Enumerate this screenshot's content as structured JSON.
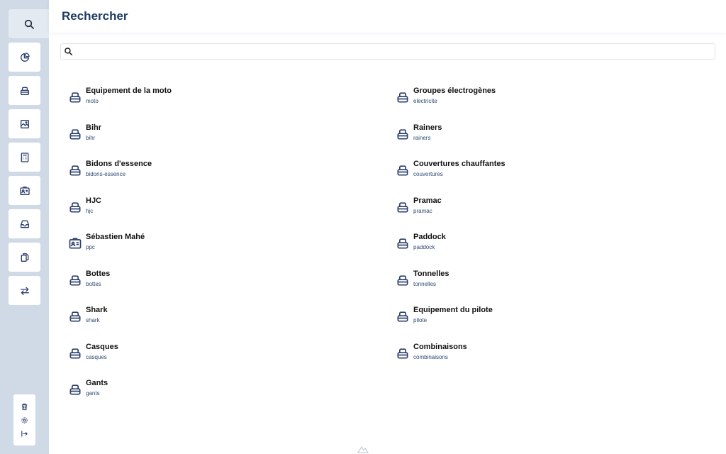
{
  "page": {
    "title": "Rechercher"
  },
  "search": {
    "value": "",
    "placeholder": ""
  },
  "sidebar": {
    "items": [
      {
        "icon": "search-icon",
        "active": true
      },
      {
        "icon": "pie-chart-icon"
      },
      {
        "icon": "category-icon"
      },
      {
        "icon": "image-icon"
      },
      {
        "icon": "calculator-icon"
      },
      {
        "icon": "id-card-icon"
      },
      {
        "icon": "inbox-icon"
      },
      {
        "icon": "copy-icon"
      },
      {
        "icon": "transfer-icon"
      }
    ],
    "bottom": [
      {
        "icon": "trash-icon"
      },
      {
        "icon": "settings-icon"
      },
      {
        "icon": "logout-icon"
      }
    ]
  },
  "results": {
    "left": [
      {
        "title": "Equipement de la moto",
        "slug": "moto",
        "icon": "category-icon"
      },
      {
        "title": "Bihr",
        "slug": "bihr",
        "icon": "category-icon"
      },
      {
        "title": "Bidons d'essence",
        "slug": "bidons-essence",
        "icon": "category-icon"
      },
      {
        "title": "HJC",
        "slug": "hjc",
        "icon": "category-icon"
      },
      {
        "title": "Sébastien Mahé",
        "slug": "ppc",
        "icon": "id-card-icon"
      },
      {
        "title": "Bottes",
        "slug": "bottes",
        "icon": "category-icon"
      },
      {
        "title": "Shark",
        "slug": "shark",
        "icon": "category-icon"
      },
      {
        "title": "Casques",
        "slug": "casques",
        "icon": "category-icon"
      },
      {
        "title": "Gants",
        "slug": "gants",
        "icon": "category-icon"
      }
    ],
    "right": [
      {
        "title": "Groupes électrogènes",
        "slug": "electricite",
        "icon": "category-icon"
      },
      {
        "title": "Rainers",
        "slug": "rainers",
        "icon": "category-icon"
      },
      {
        "title": "Couvertures chauffantes",
        "slug": "couvertures",
        "icon": "category-icon"
      },
      {
        "title": "Pramac",
        "slug": "pramac",
        "icon": "category-icon"
      },
      {
        "title": "Paddock",
        "slug": "paddock",
        "icon": "category-icon"
      },
      {
        "title": "Tonnelles",
        "slug": "tonnelles",
        "icon": "category-icon"
      },
      {
        "title": "Equipement du pilote",
        "slug": "pilote",
        "icon": "category-icon"
      },
      {
        "title": "Combinaisons",
        "slug": "combinaisons",
        "icon": "category-icon"
      }
    ]
  },
  "colors": {
    "sidebar": "#cfdae6",
    "title": "#1f3b63",
    "icon": "#2b3f6b",
    "slug": "#2e4a72"
  }
}
